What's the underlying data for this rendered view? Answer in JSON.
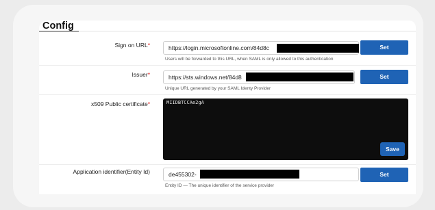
{
  "config": {
    "title": "Config",
    "sign_on_url": {
      "label": "Sign on URL",
      "required_mark": "*",
      "value": "https://login.microsoftonline.com/84d8c",
      "button": "Set",
      "hint": "Users will be forwarded to this URL, when SAML is only allowed to this authentication"
    },
    "issuer": {
      "label": "Issuer",
      "required_mark": "*",
      "value": "https://sts.windows.net/84d8",
      "button": "Set",
      "hint": "Unique URL generated by your SAML Identy Provider"
    },
    "certificate": {
      "label": "x509 Public certificate",
      "required_mark": "*",
      "value": "MIIDBTCCAe2gA",
      "button": "Save"
    },
    "entity_id": {
      "label": "Application identifier(Entity Id)",
      "value": "de455302-",
      "button": "Set",
      "hint": "Entity ID — The unique identifier of the service provider"
    }
  }
}
